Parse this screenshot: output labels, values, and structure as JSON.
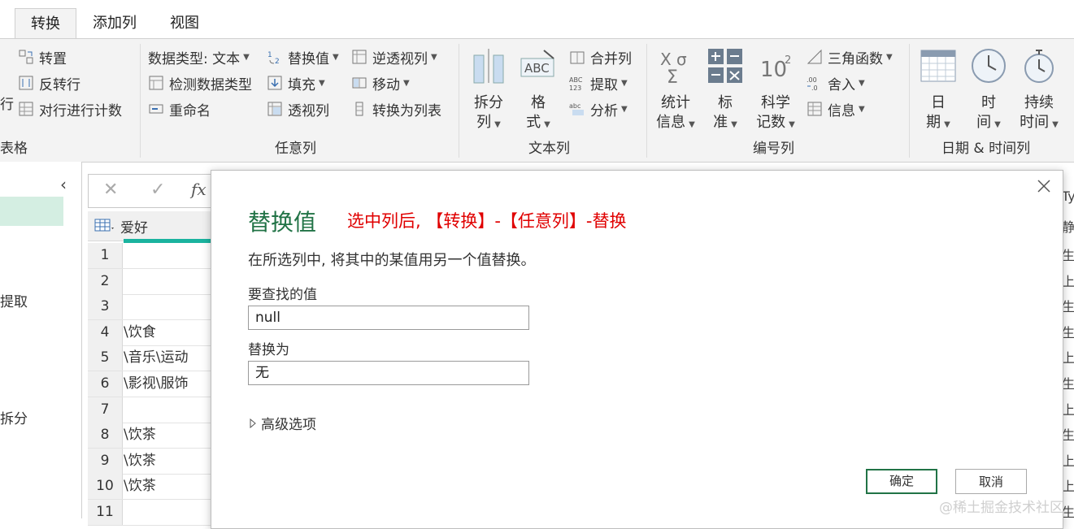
{
  "tabs": [
    "转换",
    "添加列",
    "视图"
  ],
  "ribbon": {
    "table_group": {
      "label": "表格",
      "items": [
        "转置",
        "反转行",
        "对行进行计数"
      ],
      "left_fragment": "行"
    },
    "anycol_group": {
      "label": "任意列",
      "datatype": "数据类型: 文本",
      "detect": "检测数据类型",
      "rename": "重命名",
      "replace": "替换值",
      "fill": "填充",
      "pivot": "透视列",
      "unpivot": "逆透视列",
      "move": "移动",
      "tolist": "转换为列表"
    },
    "textcol_group": {
      "label": "文本列",
      "split_top": "拆分",
      "split_bottom": "列",
      "format_top": "格",
      "format_bottom": "式",
      "merge": "合并列",
      "extract": "提取",
      "parse": "分析"
    },
    "numcol_group": {
      "label": "编号列",
      "stats_top": "统计",
      "stats_bottom": "信息",
      "std_top": "标",
      "std_bottom": "准",
      "sci_top": "科学",
      "sci_bottom": "记数",
      "trig": "三角函数",
      "round": "舍入",
      "info": "信息"
    },
    "datetime_group": {
      "label": "日期 & 时间列",
      "date_top": "日",
      "date_bottom": "期",
      "time_top": "时",
      "time_bottom": "间",
      "dur_top": "持续",
      "dur_bottom": "时间"
    }
  },
  "left_pane": [
    "提取",
    "拆分"
  ],
  "grid": {
    "header": "爱好",
    "rows": [
      {
        "num": "1",
        "val": ""
      },
      {
        "num": "2",
        "val": ""
      },
      {
        "num": "3",
        "val": ""
      },
      {
        "num": "4",
        "val": "\\饮食"
      },
      {
        "num": "5",
        "val": "\\音乐\\运动"
      },
      {
        "num": "6",
        "val": "\\影视\\服饰"
      },
      {
        "num": "7",
        "val": ""
      },
      {
        "num": "8",
        "val": "\\饮茶"
      },
      {
        "num": "9",
        "val": "\\饮茶"
      },
      {
        "num": "10",
        "val": "\\饮茶"
      },
      {
        "num": "11",
        "val": ""
      }
    ],
    "right_header": "Ty",
    "right_sub": "静",
    "right_cells": [
      "生",
      "上",
      "生",
      "生",
      "上",
      "生",
      "上",
      "生",
      "上",
      "上",
      "生"
    ]
  },
  "dialog": {
    "title": "替换值",
    "annotation": "选中列后, 【转换】-【任意列】-替换",
    "description": "在所选列中, 将其中的某值用另一个值替换。",
    "find_label": "要查找的值",
    "find_value": "null",
    "replace_label": "替换为",
    "replace_value": "无",
    "advanced": "高级选项",
    "ok": "确定",
    "cancel": "取消"
  },
  "watermark": "@稀土掘金技术社区"
}
